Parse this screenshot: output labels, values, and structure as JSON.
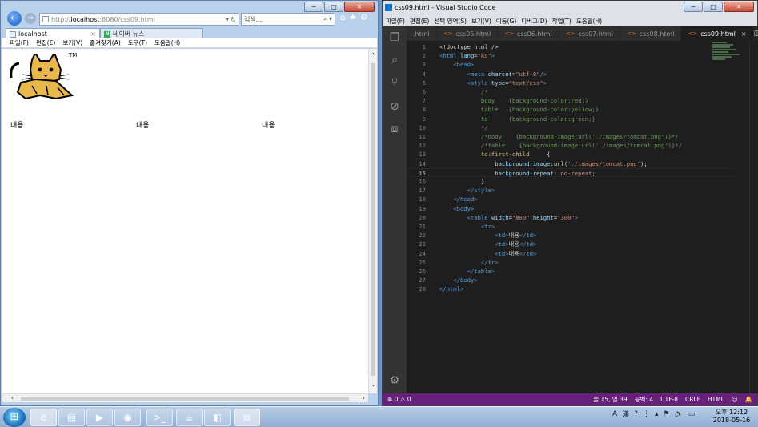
{
  "browser": {
    "window_controls": {
      "minimize": "─",
      "maximize": "□",
      "close": "✕"
    },
    "address": {
      "url_prefix": "http://",
      "url_host": "localhost",
      "url_rest": ":8080/css09.html",
      "tools": "▾ ↻"
    },
    "search": {
      "placeholder": "검색...",
      "tools": "⌕ ▾"
    },
    "tabs": [
      {
        "label": "localhost",
        "close": "×"
      },
      {
        "label": "네이버 뉴스",
        "icon_letter": "N"
      }
    ],
    "menu": [
      "파일(F)",
      "편집(E)",
      "보기(V)",
      "즐겨찾기(A)",
      "도구(T)",
      "도움말(H)"
    ],
    "page": {
      "tm_mark": "TM",
      "cells": [
        "내용",
        "내용",
        "내용"
      ]
    }
  },
  "editor": {
    "window_title": "css09.html - Visual Studio Code",
    "window_controls": {
      "minimize": "─",
      "maximize": "□",
      "close": "✕"
    },
    "menu": [
      "파일(F)",
      "편집(E)",
      "선택 영역(S)",
      "보기(V)",
      "이동(G)",
      "디버그(D)",
      "작업(T)",
      "도움말(H)"
    ],
    "tabs": [
      {
        "label": ".html",
        "active": false
      },
      {
        "label": "css05.html",
        "active": false
      },
      {
        "label": "css06.html",
        "active": false
      },
      {
        "label": "css07.html",
        "active": false
      },
      {
        "label": "css08.html",
        "active": false
      },
      {
        "label": "css09.html",
        "active": true,
        "close": "×"
      }
    ],
    "current_line": 15,
    "code_lines": [
      [
        [
          "t-txt",
          "<!doctype html />"
        ]
      ],
      [
        [
          "t-tag",
          "<html "
        ],
        [
          "t-attr",
          "lang"
        ],
        [
          "t-txt",
          "="
        ],
        [
          "t-str",
          "\"ko\""
        ],
        [
          "t-tag",
          ">"
        ]
      ],
      [
        [
          "t-txt",
          "    "
        ],
        [
          "t-tag",
          "<head>"
        ]
      ],
      [
        [
          "t-txt",
          "        "
        ],
        [
          "t-tag",
          "<meta "
        ],
        [
          "t-attr",
          "charset"
        ],
        [
          "t-txt",
          "="
        ],
        [
          "t-str",
          "\"utf-8\""
        ],
        [
          "t-tag",
          "/>"
        ]
      ],
      [
        [
          "t-txt",
          "        "
        ],
        [
          "t-tag",
          "<style "
        ],
        [
          "t-attr",
          "type"
        ],
        [
          "t-txt",
          "="
        ],
        [
          "t-str",
          "\"text/css\""
        ],
        [
          "t-tag",
          ">"
        ]
      ],
      [
        [
          "t-com",
          "            /*"
        ]
      ],
      [
        [
          "t-com",
          "            body    {background-color:red;}"
        ]
      ],
      [
        [
          "t-com",
          "            table   {background-color:yellow;}"
        ]
      ],
      [
        [
          "t-com",
          "            td      {background-color:green;}"
        ]
      ],
      [
        [
          "t-com",
          "            */"
        ]
      ],
      [
        [
          "t-com",
          "            /*body    {background-image:url('./images/tomcat.png')}*/"
        ]
      ],
      [
        [
          "t-com",
          "            /*table    {background-image:url('./images/tomcat.png')}*/"
        ]
      ],
      [
        [
          "t-txt",
          "            "
        ],
        [
          "t-sel",
          "td:first-child"
        ],
        [
          "t-txt",
          "     {"
        ]
      ],
      [
        [
          "t-txt",
          "                "
        ],
        [
          "t-attr",
          "background-image"
        ],
        [
          "t-txt",
          ":"
        ],
        [
          "t-fn",
          "url"
        ],
        [
          "t-txt",
          "("
        ],
        [
          "t-str",
          "'./images/tomcat.png'"
        ],
        [
          "t-txt",
          ");"
        ]
      ],
      [
        [
          "t-txt",
          "                "
        ],
        [
          "t-attr",
          "background-repeat"
        ],
        [
          "t-txt",
          ": "
        ],
        [
          "t-str",
          "no-repeat"
        ],
        [
          "t-txt",
          ";"
        ]
      ],
      [
        [
          "t-txt",
          "            }"
        ]
      ],
      [
        [
          "t-txt",
          "        "
        ],
        [
          "t-tag",
          "</style>"
        ]
      ],
      [
        [
          "t-txt",
          "    "
        ],
        [
          "t-tag",
          "</head>"
        ]
      ],
      [
        [
          "t-txt",
          "    "
        ],
        [
          "t-tag",
          "<body>"
        ]
      ],
      [
        [
          "t-txt",
          "        "
        ],
        [
          "t-tag",
          "<table "
        ],
        [
          "t-attr",
          "width"
        ],
        [
          "t-txt",
          "="
        ],
        [
          "t-str",
          "\"800\""
        ],
        [
          "t-txt",
          " "
        ],
        [
          "t-attr",
          "height"
        ],
        [
          "t-txt",
          "="
        ],
        [
          "t-str",
          "\"300\""
        ],
        [
          "t-tag",
          ">"
        ]
      ],
      [
        [
          "t-txt",
          "            "
        ],
        [
          "t-tag",
          "<tr>"
        ]
      ],
      [
        [
          "t-txt",
          "                "
        ],
        [
          "t-tag",
          "<td>"
        ],
        [
          "t-txt",
          "내용"
        ],
        [
          "t-tag",
          "</td>"
        ]
      ],
      [
        [
          "t-txt",
          "                "
        ],
        [
          "t-tag",
          "<td>"
        ],
        [
          "t-txt",
          "내용"
        ],
        [
          "t-tag",
          "</td>"
        ]
      ],
      [
        [
          "t-txt",
          "                "
        ],
        [
          "t-tag",
          "<td>"
        ],
        [
          "t-txt",
          "내용"
        ],
        [
          "t-tag",
          "</td>"
        ]
      ],
      [
        [
          "t-txt",
          "            "
        ],
        [
          "t-tag",
          "</tr>"
        ]
      ],
      [
        [
          "t-txt",
          "        "
        ],
        [
          "t-tag",
          "</table>"
        ]
      ],
      [
        [
          "t-txt",
          "    "
        ],
        [
          "t-tag",
          "</body>"
        ]
      ],
      [
        [
          "t-tag",
          "</html>"
        ]
      ]
    ],
    "status": {
      "problems": "⊗ 0 ⚠ 0",
      "position": "줄 15, 열 39",
      "spaces": "공백: 4",
      "encoding": "UTF-8",
      "eol": "CRLF",
      "language": "HTML",
      "smiley": "☺",
      "bell": "🔔"
    }
  },
  "taskbar": {
    "start_glyph": "⊞",
    "items": [
      {
        "name": "ie",
        "glyph": "e"
      },
      {
        "name": "explorer",
        "glyph": "▤"
      },
      {
        "name": "media",
        "glyph": "▶"
      },
      {
        "name": "chrome",
        "glyph": "◉"
      },
      {
        "name": "cmd",
        "glyph": ">_"
      },
      {
        "name": "java",
        "glyph": "☕"
      },
      {
        "name": "eclipse",
        "glyph": "◧"
      },
      {
        "name": "vscode",
        "glyph": "⧉"
      }
    ],
    "tray": {
      "lang_a": "A",
      "lang_han": "漢",
      "help": "?",
      "misc": "⋮",
      "arrow": "▴",
      "flag": "⚑",
      "speaker": "🔊",
      "network": "▭"
    },
    "clock": {
      "time": "오후 12:12",
      "date": "2018-05-16"
    }
  }
}
